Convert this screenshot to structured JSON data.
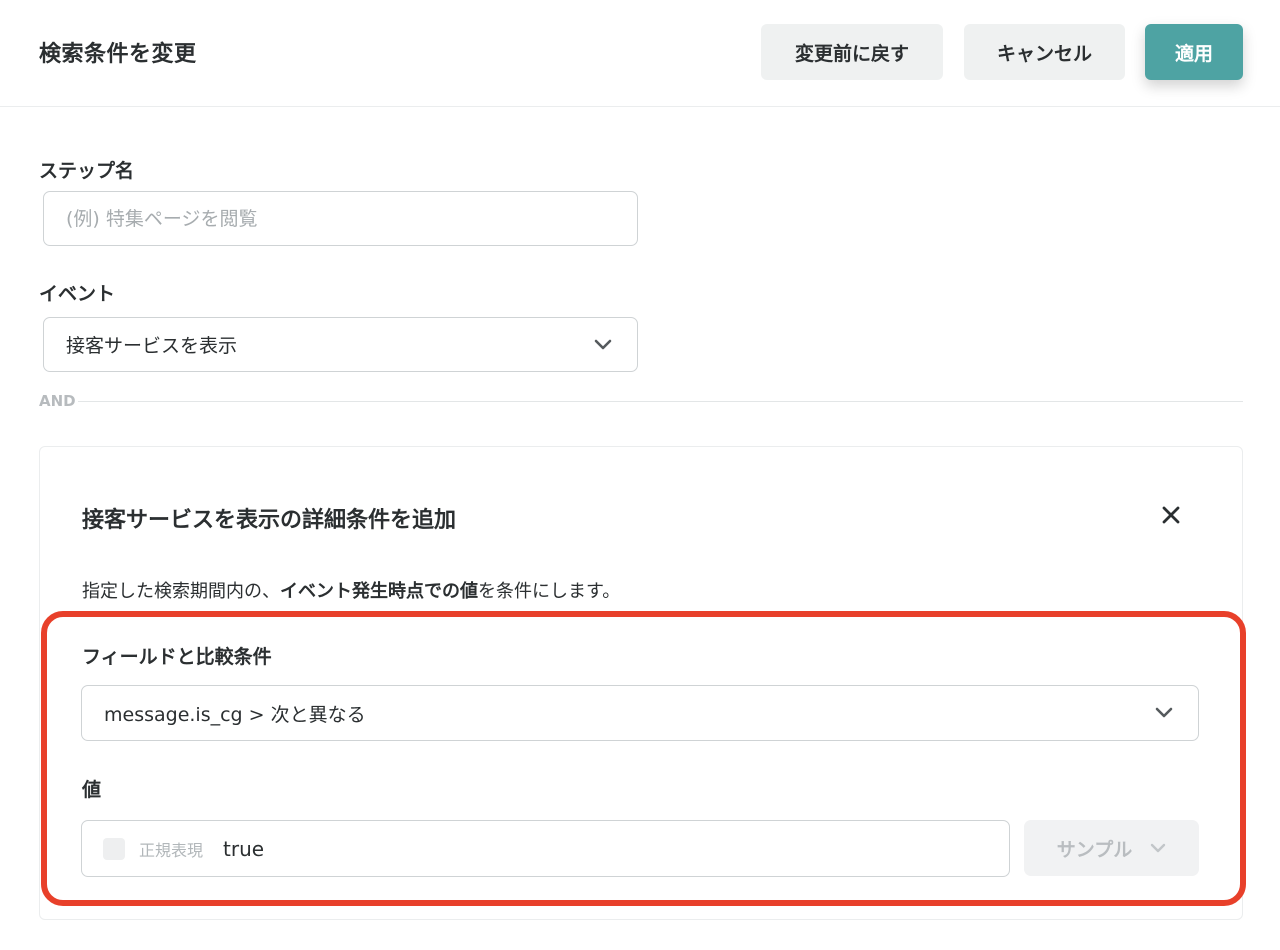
{
  "header": {
    "title": "検索条件を変更",
    "revert_label": "変更前に戻す",
    "cancel_label": "キャンセル",
    "apply_label": "適用"
  },
  "form": {
    "step_name_label": "ステップ名",
    "step_name_placeholder": "(例) 特集ページを閲覧",
    "step_name_value": "",
    "event_label": "イベント",
    "event_value": "接客サービスを表示",
    "and_label": "AND"
  },
  "detail": {
    "title": "接客サービスを表示の詳細条件を追加",
    "desc_pre": "指定した検索期間内の、",
    "desc_bold": "イベント発生時点での値",
    "desc_post": "を条件にします。",
    "field_label": "フィールドと比較条件",
    "field_value": "message.is_cg > 次と異なる",
    "value_label": "値",
    "regex_label": "正規表現",
    "regex_checked": false,
    "value_text": "true",
    "sample_label": "サンプル"
  },
  "colors": {
    "accent": "#4ea3a3",
    "highlight": "#e8402a"
  },
  "icons": {
    "event_dropdown": "chevron-down-icon",
    "field_dropdown": "chevron-down-icon",
    "sample_dropdown": "chevron-down-icon",
    "close": "close-icon"
  }
}
